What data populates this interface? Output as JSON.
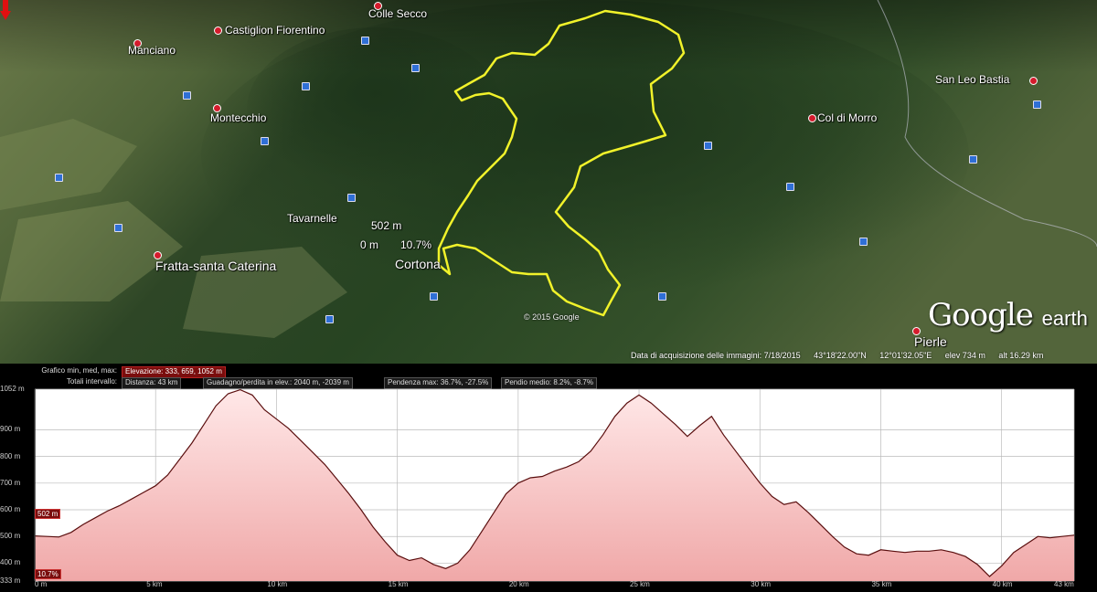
{
  "map": {
    "places": [
      {
        "name": "Colle Secco"
      },
      {
        "name": "Castiglion Fiorentino"
      },
      {
        "name": "Manciano"
      },
      {
        "name": "Montecchio"
      },
      {
        "name": "Tavarnelle"
      },
      {
        "name": "Fratta-santa Caterina"
      },
      {
        "name": "Cortona"
      },
      {
        "name": "San Leo Bastia"
      },
      {
        "name": "Col di Morro"
      },
      {
        "name": "Pierle"
      }
    ],
    "cursor": {
      "elevation": "502 m",
      "distance": "0 m",
      "slope": "10.7%"
    },
    "copyright": "© 2015 Google",
    "logo": {
      "google": "Google",
      "earth": "earth"
    },
    "status": {
      "acquisition": "Data di acquisizione delle immagini: 7/18/2015",
      "lat": "43°18'22.00\"N",
      "lon": "12°01'32.05\"E",
      "elev": "elev  734 m",
      "alt": "alt  16.29 km"
    }
  },
  "profile_info": {
    "row1_label": "Grafico  min, med, max:",
    "elevazione": "Elevazione: 333, 659, 1052 m",
    "row2_label": "Totali intervallo:",
    "distanza": "Distanza: 43 km",
    "guadagno": "Guadagno/perdita in elev.: 2040 m, -2039 m",
    "pendenza_max": "Pendenza max: 36.7%, -27.5%",
    "pendio_medio": "Pendio medio: 8.2%, -8.7%"
  },
  "chart_data": {
    "type": "area",
    "title": "",
    "xlabel": "",
    "ylabel": "",
    "xlim": [
      0,
      43
    ],
    "ylim": [
      333,
      1052
    ],
    "x_ticks": [
      "0 m",
      "5 km",
      "10 km",
      "15 km",
      "20 km",
      "25 km",
      "30 km",
      "35 km",
      "40 km",
      "43 km"
    ],
    "y_ticks": [
      "1052 m",
      "900 m",
      "800 m",
      "700 m",
      "600 m",
      "500 m",
      "400 m",
      "333 m"
    ],
    "series": [
      {
        "x": [
          0,
          0.5,
          1,
          1.5,
          2,
          2.5,
          3,
          3.5,
          4,
          4.5,
          5,
          5.5,
          6,
          6.5,
          7,
          7.5,
          8,
          8.5,
          9,
          9.5,
          10,
          10.5,
          11,
          11.5,
          12,
          12.5,
          13,
          13.5,
          14,
          14.5,
          15,
          15.5,
          16,
          16.5,
          17,
          17.5,
          18,
          18.5,
          19,
          19.5,
          20,
          20.5,
          21,
          21.5,
          22,
          22.5,
          23,
          23.5,
          24,
          24.5,
          25,
          25.5,
          26,
          26.5,
          27,
          27.5,
          28,
          28.5,
          29,
          29.5,
          30,
          30.5,
          31,
          31.5,
          32,
          32.5,
          33,
          33.5,
          34,
          34.5,
          35,
          35.5,
          36,
          36.5,
          37,
          37.5,
          38,
          38.5,
          39,
          39.5,
          40,
          40.5,
          41,
          41.5,
          42,
          42.5,
          43
        ],
        "y": [
          502,
          500,
          498,
          515,
          545,
          570,
          595,
          615,
          640,
          665,
          690,
          730,
          790,
          850,
          920,
          990,
          1035,
          1050,
          1030,
          975,
          940,
          905,
          860,
          815,
          770,
          715,
          660,
          600,
          535,
          480,
          430,
          410,
          420,
          395,
          380,
          400,
          450,
          520,
          590,
          660,
          700,
          720,
          725,
          745,
          760,
          780,
          820,
          880,
          950,
          1000,
          1030,
          1000,
          960,
          920,
          875,
          915,
          950,
          880,
          820,
          760,
          700,
          650,
          620,
          630,
          590,
          545,
          500,
          460,
          435,
          430,
          450,
          445,
          440,
          445,
          445,
          450,
          440,
          425,
          395,
          350,
          390,
          440,
          470,
          500,
          495,
          500,
          505
        ]
      }
    ]
  }
}
